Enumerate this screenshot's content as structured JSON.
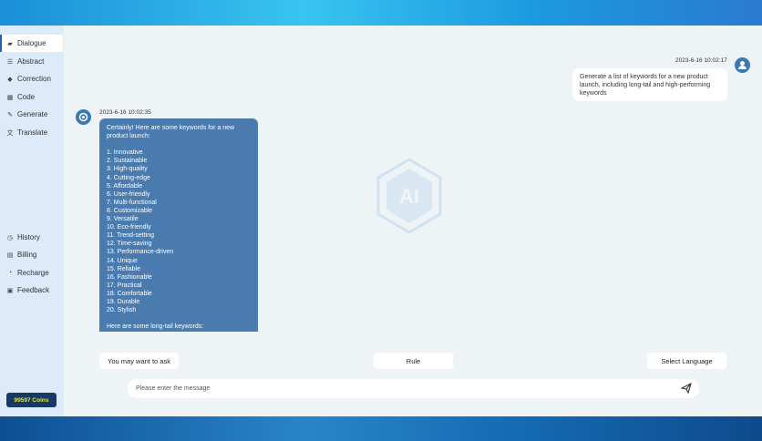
{
  "sidebar": {
    "items": [
      {
        "label": "Dialogue",
        "icon": "chat-icon",
        "active": true
      },
      {
        "label": "Abstract",
        "icon": "abstract-icon"
      },
      {
        "label": "Correction",
        "icon": "correction-icon"
      },
      {
        "label": "Code",
        "icon": "code-icon"
      },
      {
        "label": "Generate",
        "icon": "generate-icon"
      },
      {
        "label": "Translate",
        "icon": "translate-icon"
      }
    ],
    "bottom_items": [
      {
        "label": "History",
        "icon": "history-icon"
      },
      {
        "label": "Billing",
        "icon": "billing-icon"
      },
      {
        "label": "Recharge",
        "icon": "recharge-icon"
      },
      {
        "label": "Feedback",
        "icon": "feedback-icon"
      }
    ],
    "coins": "99597 Coins"
  },
  "chat": {
    "user_time": "2023-6-16 10:02:17",
    "user_text": "Generate a list of keywords for a new product launch, including long-tail and high-performing keywords",
    "bot_time": "2023-6-16 10:02:35",
    "bot_text": "Certainly! Here are some keywords for a new product launch:\n\n1. Innovative\n2. Sustainable\n3. High-quality\n4. Cutting-edge\n5. Affordable\n6. User-friendly\n7. Multi-functional\n8. Customizable\n9. Versatile\n10. Eco-friendly\n11. Trend-setting\n12. Time-saving\n13. Performance-driven\n14. Unique\n15. Reliable\n16. Fashionable\n17. Practical\n18. Comfortable\n19. Durable\n20. Stylish\n\nHere are some long-tail keywords:"
  },
  "watermark": "AI",
  "actions": {
    "ask": "You may want to ask",
    "rule": "Rule",
    "language": "Select Language"
  },
  "input": {
    "placeholder": "Please enter the message",
    "value": ""
  },
  "colors": {
    "accent": "#4a7bae",
    "sidebar": "#dceaf9",
    "coins_bg": "#163a63"
  }
}
